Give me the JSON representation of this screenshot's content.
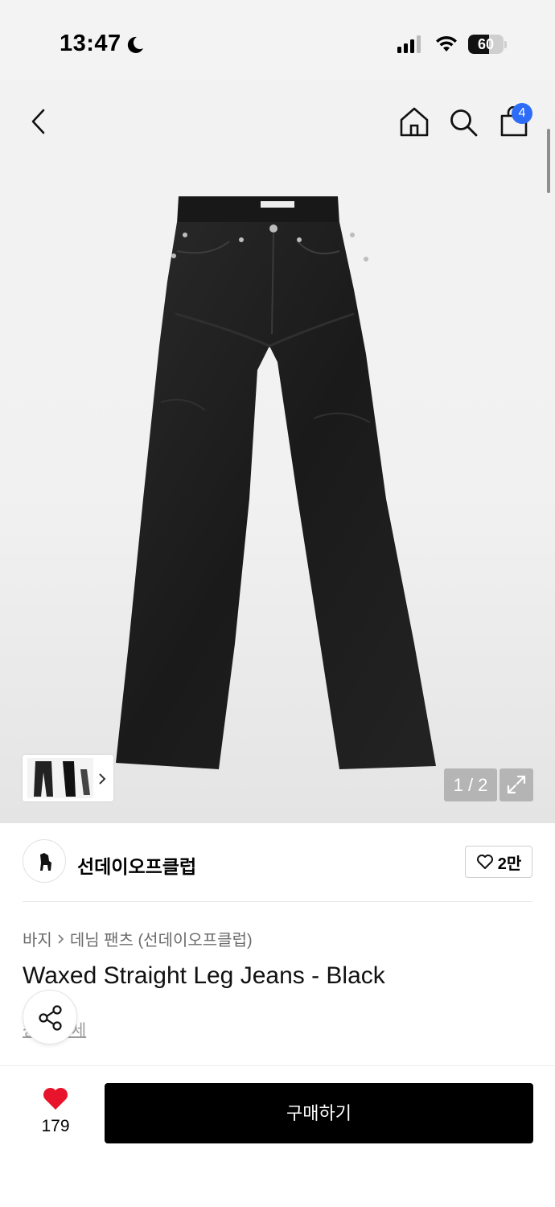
{
  "status_bar": {
    "time": "13:47",
    "battery": "60",
    "battery_level": 0.6
  },
  "nav": {
    "cart_count": "4"
  },
  "gallery": {
    "page_indicator": "1 / 2"
  },
  "brand": {
    "name": "선데이오프클럽",
    "like_count": "2만"
  },
  "product": {
    "breadcrumb": [
      "바지",
      "데님 팬츠 (선데이오프클럽)"
    ],
    "title": "Waxed Straight Leg Jeans - Black",
    "partial_link": "상품 상세"
  },
  "bottom": {
    "fav_count": "179",
    "buy_label": "구매하기"
  },
  "colors": {
    "accent_blue": "#2c6cf6",
    "heart_red": "#e8142b",
    "buy_bg": "#000000"
  },
  "icons": [
    "moon-icon",
    "signal-icon",
    "wifi-icon",
    "back-icon",
    "home-icon",
    "search-icon",
    "cart-icon",
    "chevron-right-icon",
    "expand-icon",
    "heart-outline-icon",
    "share-icon",
    "heart-filled-icon"
  ]
}
